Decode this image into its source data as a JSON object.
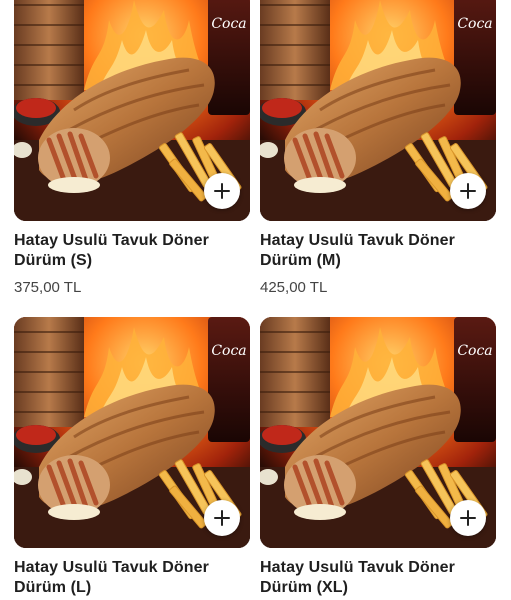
{
  "products": [
    {
      "name": "Hatay Usulü Tavuk Döner Dürüm (S)",
      "price": "375,00 TL",
      "add_icon": "plus-icon"
    },
    {
      "name": "Hatay Usulü Tavuk Döner Dürüm (M)",
      "price": "425,00 TL",
      "add_icon": "plus-icon"
    },
    {
      "name": "Hatay Usulü Tavuk Döner Dürüm (L)",
      "price": "",
      "add_icon": "plus-icon"
    },
    {
      "name": "Hatay Usulü Tavuk Döner Dürüm (XL)",
      "price": "",
      "add_icon": "plus-icon"
    }
  ],
  "photo_brand_text": "Coca-Cola",
  "colors": {
    "fire": "#ff7a1a",
    "wrap": "#c9884a",
    "sauce": "#c0281a",
    "fries": "#f3b94a",
    "text": "#1f1f1f",
    "price": "#444444"
  }
}
